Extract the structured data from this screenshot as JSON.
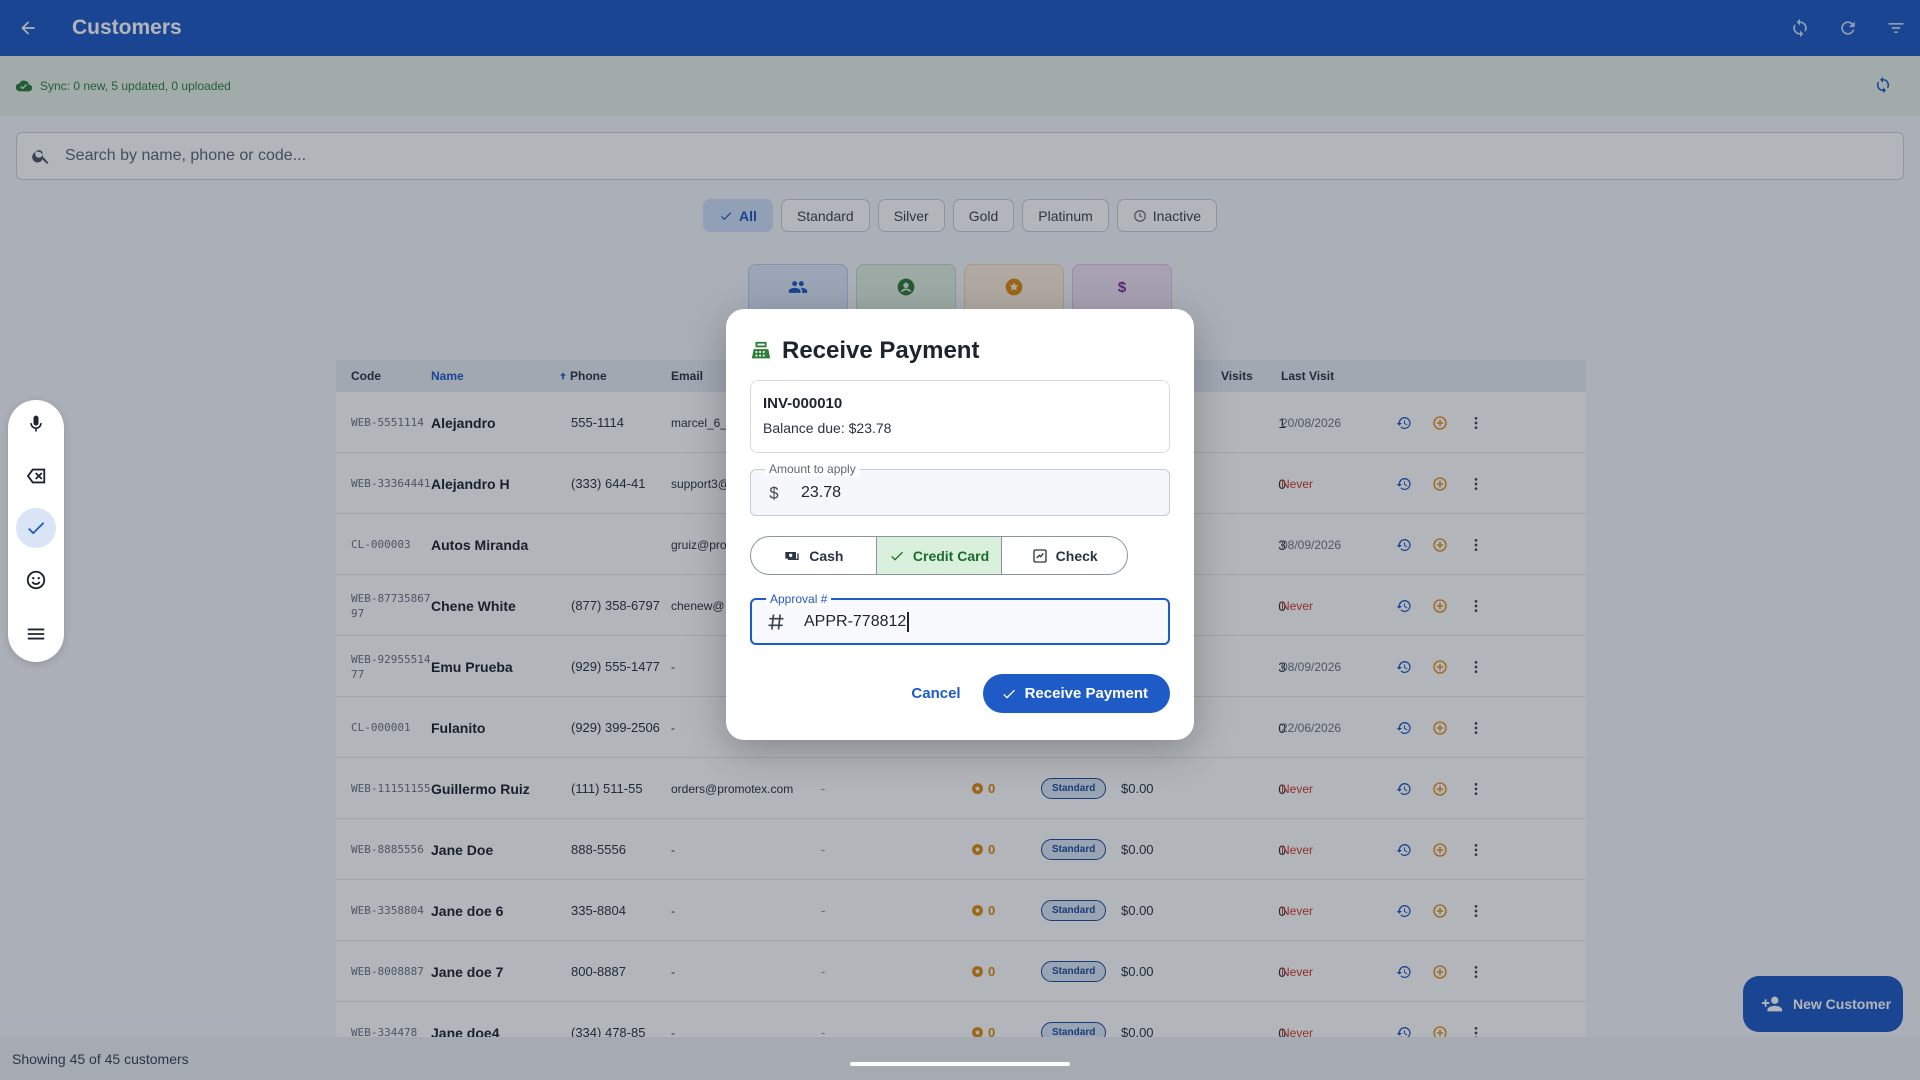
{
  "appbar": {
    "title": "Customers"
  },
  "sync": {
    "text": "Sync: 0 new, 5 updated, 0 uploaded"
  },
  "search": {
    "placeholder": "Search by name, phone or code..."
  },
  "filters": [
    {
      "label": "All",
      "selected": true
    },
    {
      "label": "Standard",
      "selected": false
    },
    {
      "label": "Silver",
      "selected": false
    },
    {
      "label": "Gold",
      "selected": false
    },
    {
      "label": "Platinum",
      "selected": false
    },
    {
      "label": "Inactive",
      "selected": false
    }
  ],
  "table": {
    "columns": {
      "code": "Code",
      "name": "Name",
      "phone": "Phone",
      "email": "Email",
      "visits": "Visits",
      "last_visit": "Last Visit"
    },
    "rows": [
      {
        "code": "WEB-5551114",
        "name": "Alejandro",
        "phone": "555-1114",
        "email": "marcel_6_",
        "dash": "",
        "points": "",
        "tier": "",
        "balance": "",
        "visits": "1",
        "last": "20/08/2026",
        "never": false
      },
      {
        "code": "WEB-33364441",
        "name": "Alejandro H",
        "phone": "(333) 644-41",
        "email": "support3@",
        "dash": "",
        "points": "",
        "tier": "",
        "balance": "",
        "visits": "0",
        "last": "Never",
        "never": true
      },
      {
        "code": "CL-000003",
        "name": "Autos Miranda",
        "phone": "",
        "email": "gruiz@pro",
        "dash": "",
        "points": "",
        "tier": "",
        "balance": "",
        "visits": "3",
        "last": "08/09/2026",
        "never": false
      },
      {
        "code": "WEB-8773586797",
        "name": "Chene White",
        "phone": "(877) 358-6797",
        "email": "chenew@",
        "dash": "",
        "points": "",
        "tier": "",
        "balance": "",
        "visits": "0",
        "last": "Never",
        "never": true
      },
      {
        "code": "WEB-9295551477",
        "name": "Emu Prueba",
        "phone": "(929) 555-1477",
        "email": "-",
        "dash": "",
        "points": "",
        "tier": "",
        "balance": "",
        "visits": "3",
        "last": "08/09/2026",
        "never": false
      },
      {
        "code": "CL-000001",
        "name": "Fulanito",
        "phone": "(929) 399-2506",
        "email": "-",
        "dash": "",
        "points": "",
        "tier": "",
        "balance": "",
        "visits": "0",
        "last": "22/06/2026",
        "never": false
      },
      {
        "code": "WEB-11151155",
        "name": "Guillermo Ruiz",
        "phone": "(111) 511-55",
        "email": "orders@promotex.com",
        "dash": "-",
        "points": "0",
        "tier": "Standard",
        "balance": "$0.00",
        "visits": "0",
        "last": "Never",
        "never": true
      },
      {
        "code": "WEB-8885556",
        "name": "Jane Doe",
        "phone": "888-5556",
        "email": "-",
        "dash": "-",
        "points": "0",
        "tier": "Standard",
        "balance": "$0.00",
        "visits": "0",
        "last": "Never",
        "never": true
      },
      {
        "code": "WEB-3358804",
        "name": "Jane doe 6",
        "phone": "335-8804",
        "email": "-",
        "dash": "-",
        "points": "0",
        "tier": "Standard",
        "balance": "$0.00",
        "visits": "0",
        "last": "Never",
        "never": true
      },
      {
        "code": "WEB-8008887",
        "name": "Jane doe 7",
        "phone": "800-8887",
        "email": "-",
        "dash": "-",
        "points": "0",
        "tier": "Standard",
        "balance": "$0.00",
        "visits": "0",
        "last": "Never",
        "never": true
      },
      {
        "code": "WEB-334478",
        "name": "Jane doe4",
        "phone": "(334) 478-85",
        "email": "-",
        "dash": "-",
        "points": "0",
        "tier": "Standard",
        "balance": "$0.00",
        "visits": "0",
        "last": "Never",
        "never": true
      }
    ]
  },
  "footer": {
    "text": "Showing 45 of 45 customers"
  },
  "fab": {
    "label": "New Customer"
  },
  "dialog": {
    "title": "Receive Payment",
    "invoice": "INV-000010",
    "balance": "Balance due: $23.78",
    "amount_label": "Amount to apply",
    "amount_value": "23.78",
    "methods": [
      {
        "label": "Cash",
        "icon": "cash-icon",
        "selected": false
      },
      {
        "label": "Credit Card",
        "icon": "check-icon",
        "selected": true
      },
      {
        "label": "Check",
        "icon": "cheque-icon",
        "selected": false
      }
    ],
    "approval_label": "Approval #",
    "approval_value": "APPR-778812",
    "cancel": "Cancel",
    "submit": "Receive Payment"
  },
  "colors": {
    "primary": "#1e5bc6",
    "success": "#1c6b2c",
    "danger": "#d03a2f",
    "points": "#e08a0f"
  }
}
